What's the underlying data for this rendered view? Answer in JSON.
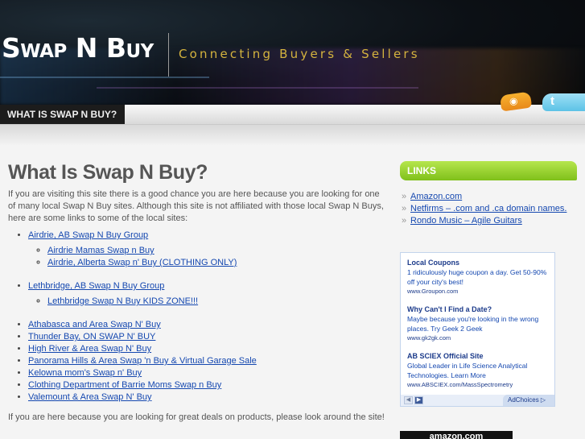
{
  "header": {
    "logo": "Swap N Buy",
    "tagline": "Connecting Buyers & Sellers"
  },
  "nav": {
    "active_tab": "WHAT IS SWAP N BUY?"
  },
  "main": {
    "title": "What Is Swap N Buy?",
    "intro": "If you are visiting this site there is a good chance you are here because you are looking for one of many local Swap N Buy sites.  Although this site is not affiliated with those local Swap N Buys, here are some links to some of the local sites:",
    "groups": [
      {
        "label": "Airdrie, AB Swap N Buy Group",
        "children": [
          "Airdrie Mamas Swap n Buy",
          "Airdrie, Alberta Swap n' Buy (CLOTHING ONLY)"
        ]
      },
      {
        "label": "Lethbridge, AB Swap N Buy Group",
        "children": [
          "Lethbridge Swap N Buy KIDS ZONE!!!"
        ]
      }
    ],
    "links": [
      "Athabasca and Area Swap N' Buy",
      "Thunder Bay, ON SWAP N' BUY",
      "High River & Area Swap N' Buy",
      "Panorama Hills & Area Swap 'n Buy & Virtual Garage Sale",
      "Kelowna mom's Swap n' Buy",
      "Clothing Department of Barrie Moms Swap n Buy",
      "Valemount & Area Swap N' Buy"
    ],
    "outro": "If you are here because you are looking for great deals on products, please look around the site!"
  },
  "sidebar": {
    "links_heading": "LINKS",
    "links": [
      "Amazon.com",
      "Netfirms – .com and .ca domain names.",
      "Rondo Music – Agile Guitars"
    ],
    "ads": [
      {
        "title": "Local Coupons",
        "desc": "1 ridiculously huge coupon a day. Get 50-90% off your city's best!",
        "url": "www.Groupon.com"
      },
      {
        "title": "Why Can't I Find a Date?",
        "desc": "Maybe because you're looking in the wrong places. Try Geek 2 Geek",
        "url": "www.gk2gk.com"
      },
      {
        "title": "AB SCIEX Official Site",
        "desc": "Global Leader in Life Science Analytical Technologies. Learn More",
        "url": "www.ABSCIEX.com/MassSpectrometry"
      }
    ],
    "ad_choices": "AdChoices",
    "amazon_label": "amazon.com"
  },
  "icons": {
    "rss": "rss-icon",
    "twitter": "twitter-icon"
  },
  "colors": {
    "accent_green": "#8ccd24",
    "tagline_gold": "#d4b33e",
    "link_blue": "#1548b0"
  }
}
